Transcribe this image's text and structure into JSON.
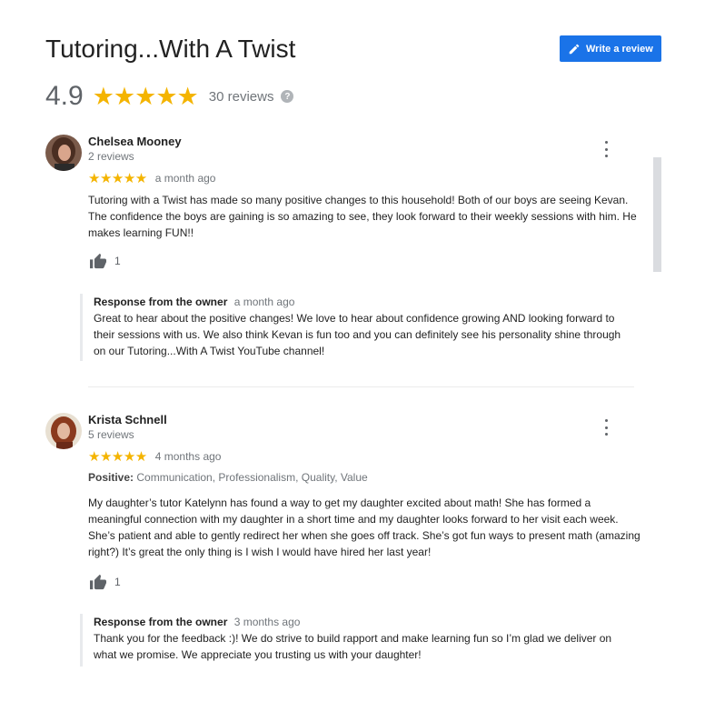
{
  "business": {
    "name": "Tutoring...With A Twist",
    "rating": "4.9",
    "stars": "★★★★★",
    "review_count": "30 reviews"
  },
  "write_review": {
    "label": "Write a review",
    "icon": "pencil-icon"
  },
  "colors": {
    "accent": "#1a73e8",
    "star": "#f4b400",
    "secondary_text": "#70757a"
  },
  "reviews": [
    {
      "name": "Chelsea Mooney",
      "reviews_count": "2 reviews",
      "stars": "★★★★★",
      "date": "a month ago",
      "text": "Tutoring with a Twist has made so many positive changes to this household! Both of our boys are seeing Kevan. The confidence the boys are gaining is so amazing to see, they look forward to their weekly sessions with him. He makes learning FUN!!",
      "likes": "1",
      "owner_response": {
        "title": "Response from the owner",
        "date": "a month ago",
        "text": "Great to hear about the positive changes! We love to hear about confidence growing AND looking forward to their sessions with us. We also think Kevan is fun too and you can definitely see his personality shine through on our Tutoring...With A Twist YouTube channel!"
      }
    },
    {
      "name": "Krista Schnell",
      "reviews_count": "5 reviews",
      "stars": "★★★★★",
      "date": "4 months ago",
      "positive_label": "Positive:",
      "positive_values": "Communication, Professionalism, Quality, Value",
      "text": "My daughter’s tutor Katelynn has found a way to get my daughter excited about math! She has formed a meaningful connection with my daughter in a short time and my daughter looks forward to her visit each week. She’s patient and able to gently redirect her when she goes off track. She’s got fun ways to present math (amazing right?) It’s great the only thing is I wish I would have hired her last year!",
      "likes": "1",
      "owner_response": {
        "title": "Response from the owner",
        "date": "3 months ago",
        "text": "Thank you for the feedback :)! We do strive to build rapport and make learning fun so I’m glad we deliver on what we promise. We appreciate you trusting us with your daughter!"
      }
    }
  ]
}
